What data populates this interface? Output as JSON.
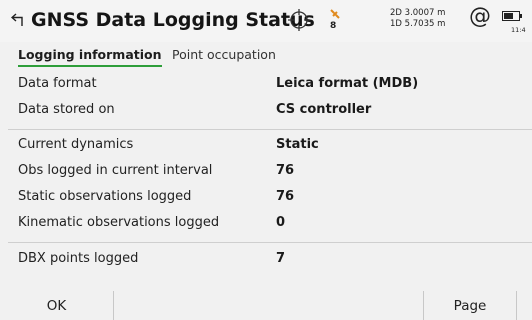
{
  "header": {
    "title": "GNSS Data Logging Status",
    "satellites": "8",
    "precision_2d": "2D 3.0007 m",
    "precision_1d": "1D 5.7035 m",
    "at_symbol": "@",
    "time": "11:4",
    "icons": [
      "back-arrow-icon",
      "crosshair-icon",
      "satellite-icon",
      "battery-icon"
    ]
  },
  "tabs": [
    {
      "label": "Logging information",
      "active": true
    },
    {
      "label": "Point occupation",
      "active": false
    }
  ],
  "rows": [
    {
      "label": "Data format",
      "value": "Leica format (MDB)"
    },
    {
      "label": "Data stored on",
      "value": "CS controller"
    },
    {
      "label": "Current dynamics",
      "value": "Static"
    },
    {
      "label": "Obs logged in current interval",
      "value": "76"
    },
    {
      "label": "Static observations logged",
      "value": "76"
    },
    {
      "label": "Kinematic observations logged",
      "value": "0"
    },
    {
      "label": "DBX points logged",
      "value": "7"
    }
  ],
  "footer": {
    "ok_label": "OK",
    "page_label": "Page"
  },
  "colors": {
    "accent": "#2e9e3a",
    "background": "#f1f1f1",
    "satellite": "#e08a1e"
  }
}
